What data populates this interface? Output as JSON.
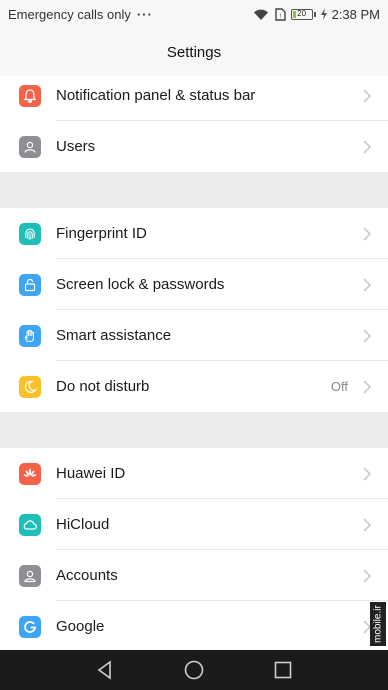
{
  "status_bar": {
    "carrier": "Emergency calls only",
    "more": "···",
    "battery": "20",
    "time": "2:38 PM"
  },
  "header": {
    "title": "Settings"
  },
  "groups": [
    {
      "items": [
        {
          "label": "Notification panel & status bar",
          "icon": "bell-icon",
          "color": "#f4624a"
        },
        {
          "label": "Users",
          "icon": "user-icon",
          "color": "#8e8e93"
        }
      ]
    },
    {
      "items": [
        {
          "label": "Fingerprint ID",
          "icon": "fingerprint-icon",
          "color": "#1fbfb8"
        },
        {
          "label": "Screen lock & passwords",
          "icon": "lock-icon",
          "color": "#3da5f4"
        },
        {
          "label": "Smart assistance",
          "icon": "hand-icon",
          "color": "#3da5f4"
        },
        {
          "label": "Do not disturb",
          "icon": "moon-icon",
          "color": "#f7c12b",
          "value": "Off"
        }
      ]
    },
    {
      "items": [
        {
          "label": "Huawei ID",
          "icon": "huawei-icon",
          "color": "#f4624a"
        },
        {
          "label": "HiCloud",
          "icon": "cloud-icon",
          "color": "#1fbfb8"
        },
        {
          "label": "Accounts",
          "icon": "account-icon",
          "color": "#8e8e93"
        },
        {
          "label": "Google",
          "icon": "google-icon",
          "color": "#3da5f4"
        }
      ]
    }
  ],
  "watermark": "mobile.ir"
}
